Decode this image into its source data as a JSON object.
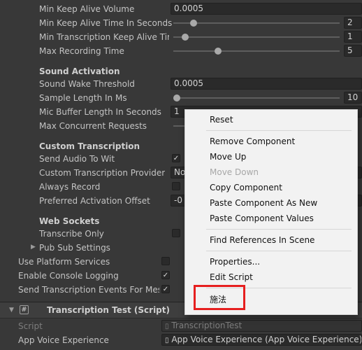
{
  "wit": {
    "min_keep_alive_volume": {
      "label": "Min Keep Alive Volume",
      "value": "0.0005"
    },
    "min_keep_alive_time": {
      "label": "Min Keep Alive Time In Seconds",
      "value": "2"
    },
    "min_transcription_keep_alive": {
      "label": "Min Transcription Keep Alive Time",
      "value": "1"
    },
    "max_recording_time": {
      "label": "Max Recording Time",
      "value": "5"
    },
    "sound_activation_header": "Sound Activation",
    "sound_wake_threshold": {
      "label": "Sound Wake Threshold",
      "value": "0.0005"
    },
    "sample_length": {
      "label": "Sample Length In Ms",
      "value": "10"
    },
    "mic_buffer_length": {
      "label": "Mic Buffer Length In Seconds",
      "value": "1"
    },
    "max_concurrent_requests": {
      "label": "Max Concurrent Requests"
    },
    "custom_transcription_header": "Custom Transcription",
    "send_audio_to_wit": {
      "label": "Send Audio To Wit",
      "checked": true
    },
    "custom_transcription_provider": {
      "label": "Custom Transcription Provider",
      "value": "No"
    },
    "always_record": {
      "label": "Always Record",
      "checked": false
    },
    "preferred_activation_offset": {
      "label": "Preferred Activation Offset",
      "value": "-0"
    },
    "web_sockets_header": "Web Sockets",
    "transcribe_only": {
      "label": "Transcribe Only",
      "checked": false
    },
    "pub_sub_settings": {
      "label": "Pub Sub Settings"
    },
    "use_platform_services": {
      "label": "Use Platform Services",
      "checked": false
    },
    "enable_console_logging": {
      "label": "Enable Console Logging",
      "checked": true
    },
    "send_transcription_events": {
      "label": "Send Transcription Events For Mess",
      "checked": true
    }
  },
  "component": {
    "title": "Transcription Test (Script)",
    "script": {
      "label": "Script",
      "value": "TranscriptionTest"
    },
    "app_voice_experience": {
      "label": "App Voice Experience",
      "value": "App Voice Experience (App Voice Experience)"
    }
  },
  "context_menu": {
    "reset": "Reset",
    "remove_component": "Remove Component",
    "move_up": "Move Up",
    "move_down": "Move Down",
    "copy_component": "Copy Component",
    "paste_as_new": "Paste Component As New",
    "paste_values": "Paste Component Values",
    "find_references": "Find References In Scene",
    "properties": "Properties...",
    "edit_script": "Edit Script",
    "custom_item": "施法"
  },
  "slider_levels": {
    "min_keep_alive_time": 0.12,
    "min_transcription_keep_alive": 0.07,
    "max_recording_time": 0.27,
    "sample_length": 0.02
  },
  "colors": {
    "highlight": "#e61f1f",
    "menu_bg": "#f2f2f2",
    "editor_bg": "#383838"
  }
}
